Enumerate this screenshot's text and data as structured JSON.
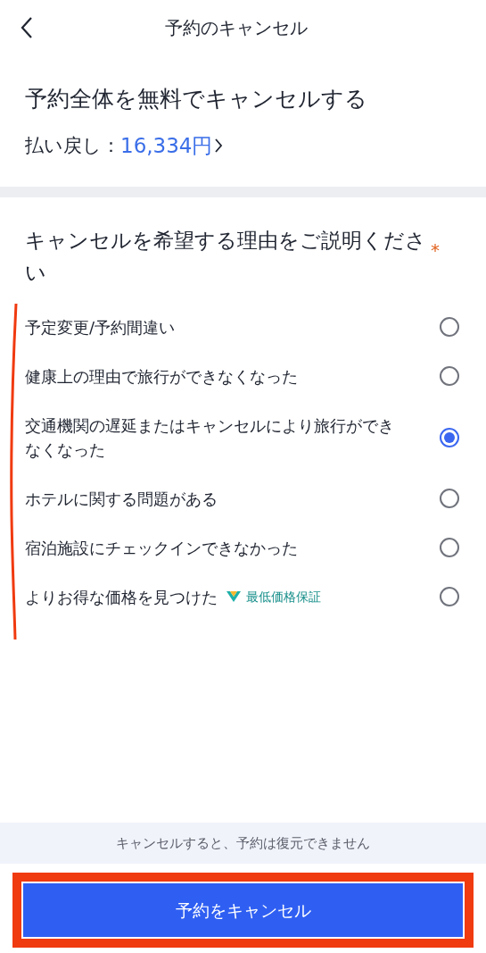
{
  "header": {
    "title": "予約のキャンセル"
  },
  "summary": {
    "title": "予約全体を無料でキャンセルする",
    "refund_label": "払い戻し：",
    "refund_amount": "16,334円"
  },
  "reasons": {
    "title": "キャンセルを希望する理由をご説明ください",
    "required_mark": "*",
    "options": [
      {
        "label": "予定変更/予約間違い",
        "selected": false
      },
      {
        "label": "健康上の理由で旅行ができなくなった",
        "selected": false
      },
      {
        "label": "交通機関の遅延またはキャンセルにより旅行ができなくなった",
        "selected": true
      },
      {
        "label": "ホテルに関する問題がある",
        "selected": false
      },
      {
        "label": "宿泊施設にチェックインできなかった",
        "selected": false
      },
      {
        "label": "よりお得な価格を見つけた",
        "badge": "最低価格保証",
        "selected": false
      }
    ]
  },
  "footer": {
    "note": "キャンセルすると、予約は復元できません",
    "button": "予約をキャンセル"
  }
}
